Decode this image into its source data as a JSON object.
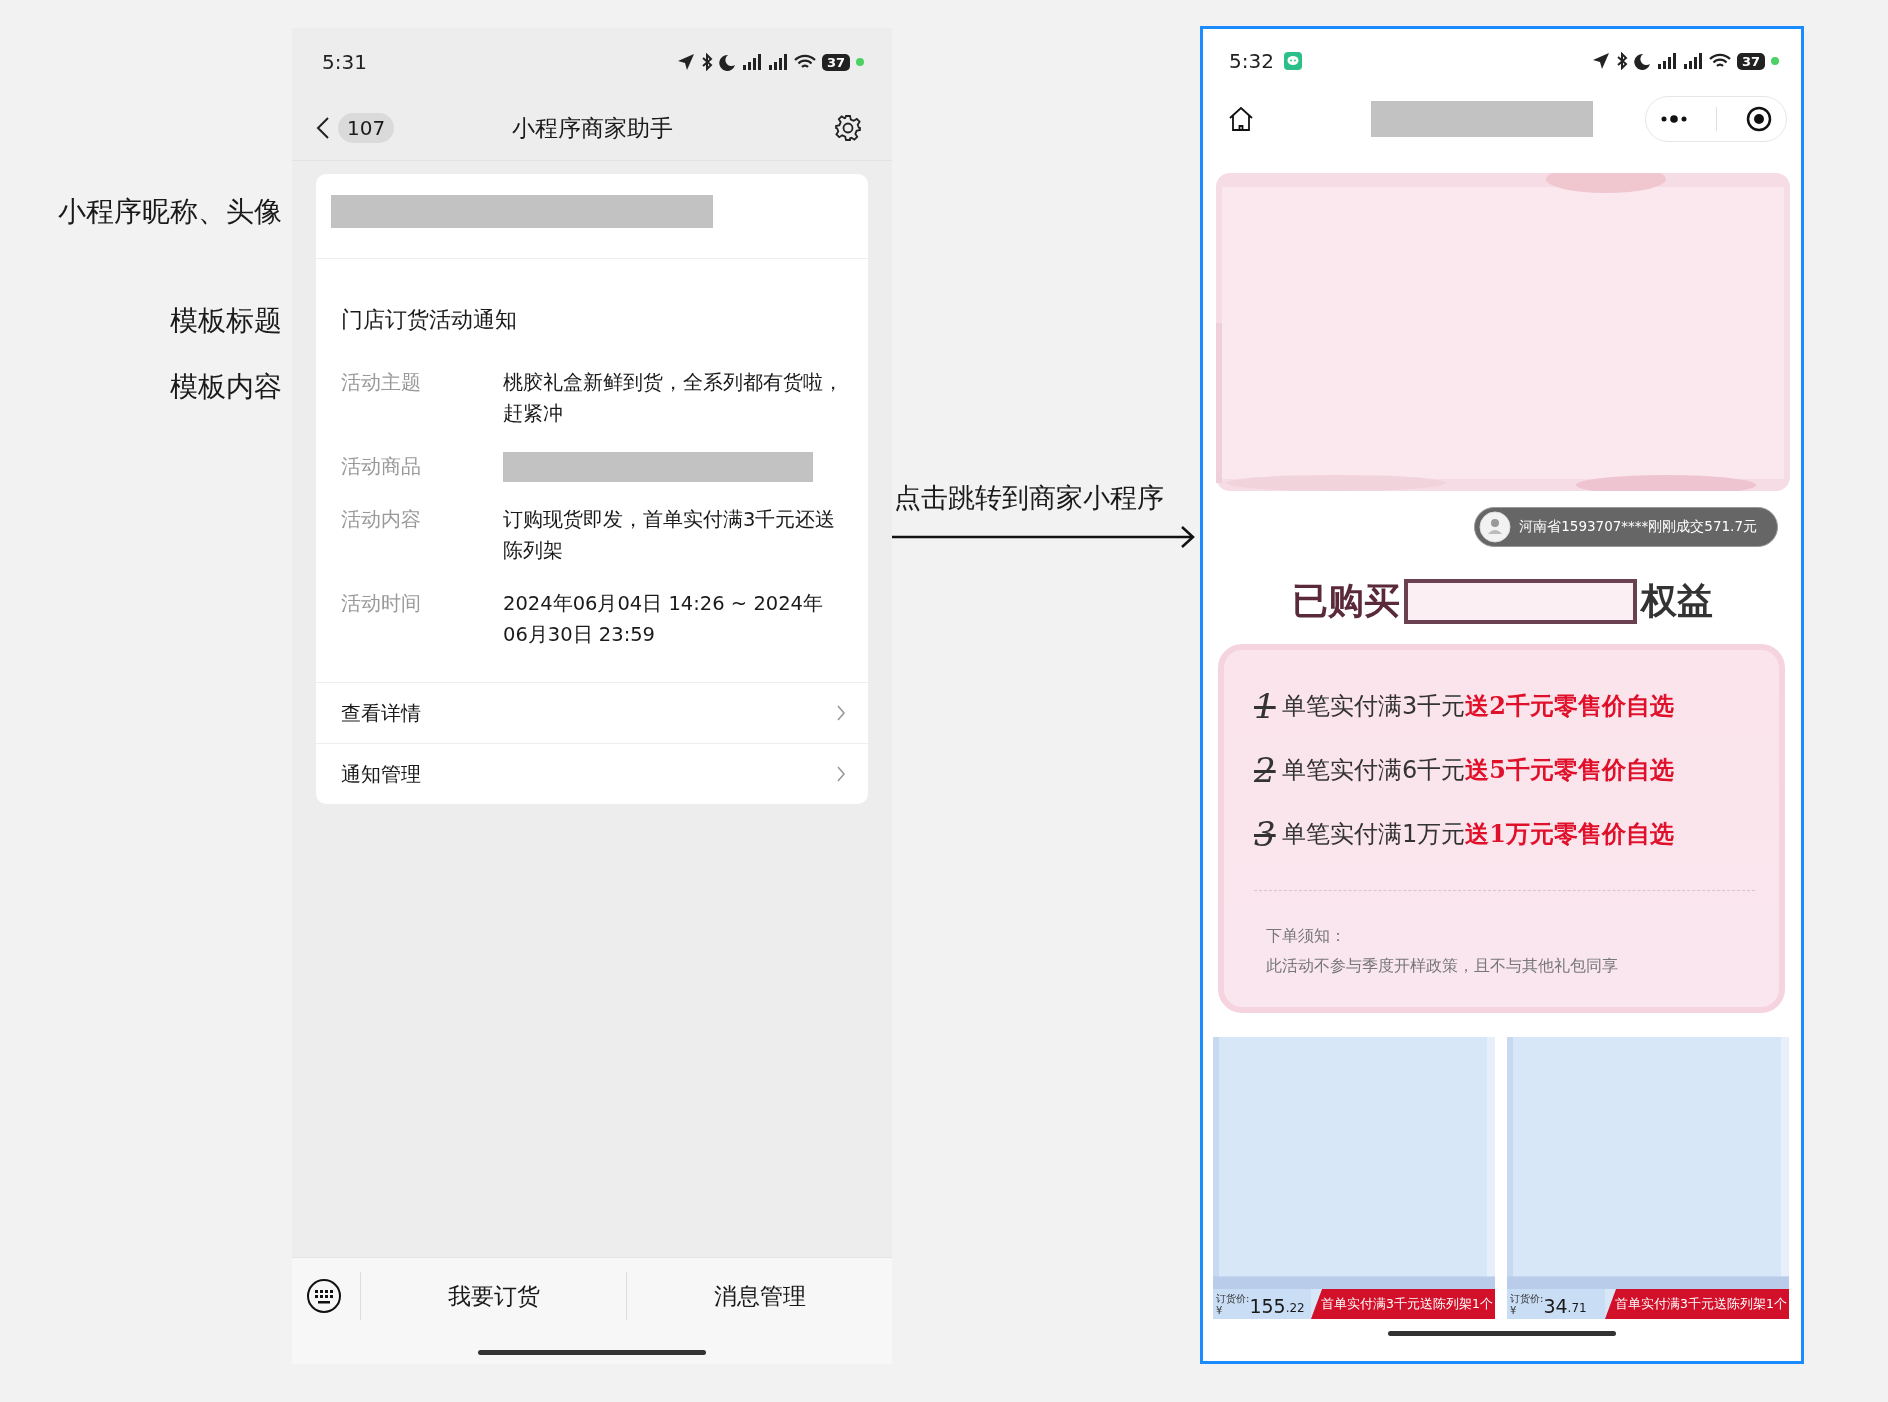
{
  "annotations": [
    {
      "text": "小程序昵称、头像"
    },
    {
      "text": "模板标题"
    },
    {
      "text": "模板内容"
    }
  ],
  "left_phone": {
    "status_bar": {
      "time": "5:31",
      "battery": "37"
    },
    "nav": {
      "badge": "107",
      "title": "小程序商家助手"
    },
    "card": {
      "template_title": "门店订货活动通知",
      "fields": [
        {
          "label": "活动主题",
          "kind": "text",
          "value": "桃胶礼盒新鲜到货，全系列都有货啦，赶紧冲"
        },
        {
          "label": "活动商品",
          "kind": "redacted"
        },
        {
          "label": "活动内容",
          "kind": "text",
          "value": "订购现货即发，首单实付满3千元还送陈列架"
        },
        {
          "label": "活动时间",
          "kind": "text",
          "value": "2024年06月04日 14:26 ~ 2024年06月30日 23:59"
        }
      ],
      "links": [
        {
          "label": "查看详情"
        },
        {
          "label": "通知管理"
        }
      ]
    },
    "bottom_bar": {
      "buttons": [
        {
          "label": "我要订货"
        },
        {
          "label": "消息管理"
        }
      ]
    }
  },
  "jump_label": "点击跳转到商家小程序",
  "right_phone": {
    "status_bar": {
      "time": "5:32",
      "battery": "37"
    },
    "notice": "河南省1593707****刚刚成交571.7元",
    "heading": {
      "before": "已购买",
      "after": "权益"
    },
    "benefits": [
      {
        "index": "1",
        "text": "单笔实付满3千元",
        "highlight": "送2千元零售价自选"
      },
      {
        "index": "2",
        "text": "单笔实付满6千元",
        "highlight": "送5千元零售价自选"
      },
      {
        "index": "3",
        "text": "单笔实付满1万元",
        "highlight": "送1万元零售价自选"
      }
    ],
    "note": {
      "title": "下单须知：",
      "text": "此活动不参与季度开样政策，且不与其他礼包同享"
    },
    "products": [
      {
        "price_label": "订货价:",
        "currency": "¥",
        "price_int": "155",
        "price_dec": ".22",
        "promo": "首单实付满3千元送陈列架1个"
      },
      {
        "price_label": "订货价:",
        "currency": "¥",
        "price_int": "34",
        "price_dec": ".71",
        "promo": "首单实付满3千元送陈列架1个"
      }
    ]
  }
}
